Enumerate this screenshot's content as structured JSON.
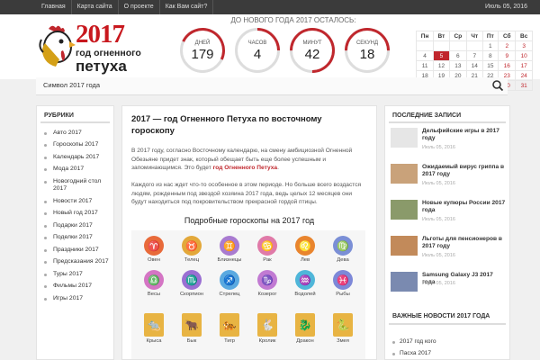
{
  "topbar": {
    "nav": [
      "Главная",
      "Карта сайта",
      "О проекте",
      "Как Вам сайт?"
    ],
    "date": "Июль 05, 2016"
  },
  "logo": {
    "year": "2017",
    "line1": "год огненного",
    "line2": "петуха"
  },
  "countdown": {
    "title": "ДО НОВОГО ГОДА 2017 ОСТАЛОСЬ:",
    "items": [
      {
        "label": "ДНЕЙ",
        "value": "179"
      },
      {
        "label": "ЧАСОВ",
        "value": "4"
      },
      {
        "label": "МИНУТ",
        "value": "42"
      },
      {
        "label": "СЕКУНД",
        "value": "18"
      }
    ]
  },
  "calendar": {
    "days": [
      "Пн",
      "Вт",
      "Ср",
      "Чт",
      "Пт",
      "Сб",
      "Вс"
    ],
    "rows": [
      [
        "",
        "",
        "",
        "",
        "1",
        "2",
        "3"
      ],
      [
        "4",
        "5",
        "6",
        "7",
        "8",
        "9",
        "10"
      ],
      [
        "11",
        "12",
        "13",
        "14",
        "15",
        "16",
        "17"
      ],
      [
        "18",
        "19",
        "20",
        "21",
        "22",
        "23",
        "24"
      ],
      [
        "25",
        "26",
        "27",
        "28",
        "29",
        "30",
        "31"
      ]
    ],
    "today": "5",
    "accent": "#c0272d"
  },
  "menu": {
    "item": "Символ 2017 года"
  },
  "left": {
    "title": "РУБРИКИ",
    "items": [
      "Авто 2017",
      "Гороскопы 2017",
      "Календарь 2017",
      "Мода 2017",
      "Новогодний стол 2017",
      "Новости 2017",
      "Новый год 2017",
      "Подарки 2017",
      "Поделки 2017",
      "Праздники 2017",
      "Предсказания 2017",
      "Туры 2017",
      "Фильмы 2017",
      "Игры 2017"
    ]
  },
  "article": {
    "title": "2017 — год Огненного Петуха по восточному гороскопу",
    "p1_pre": "В 2017 году, согласно Восточному календарю, на смену амбициозной Огненной Обезьяне придет знак, который обещает быть еще более успешным и запоминающимся. Это будет ",
    "p1_bold": "год Огненного Петуха",
    "p1_post": ".",
    "p2": "Каждого из нас ждет что-то особенное в этом периоде. Но больше всего воздастся людям, рожденным под звездой хозяина 2017 года, ведь целых 12 месяцев они будут находиться под покровительством прекрасной гордой птицы.",
    "subtitle": "Подробные гороскопы на 2017 год"
  },
  "zodiac": [
    {
      "name": "Овен",
      "glyph": "♈",
      "color": "#e86a3a"
    },
    {
      "name": "Телец",
      "glyph": "♉",
      "color": "#e3a83a"
    },
    {
      "name": "Близнецы",
      "glyph": "♊",
      "color": "#a97bd0"
    },
    {
      "name": "Рак",
      "glyph": "♋",
      "color": "#e07aa8"
    },
    {
      "name": "Лев",
      "glyph": "♌",
      "color": "#e9852e"
    },
    {
      "name": "Дева",
      "glyph": "♍",
      "color": "#7b8fd6"
    },
    {
      "name": "Весы",
      "glyph": "♎",
      "color": "#d475c4"
    },
    {
      "name": "Скорпион",
      "glyph": "♏",
      "color": "#9a6fd3"
    },
    {
      "name": "Стрелец",
      "glyph": "♐",
      "color": "#5aa9e0"
    },
    {
      "name": "Козерог",
      "glyph": "♑",
      "color": "#c17ad2"
    },
    {
      "name": "Водолей",
      "glyph": "♒",
      "color": "#4fb6d9"
    },
    {
      "name": "Рыбы",
      "glyph": "♓",
      "color": "#7d88d8"
    }
  ],
  "chinese": [
    {
      "name": "Крыса",
      "glyph": "🐀"
    },
    {
      "name": "Бык",
      "glyph": "🐂"
    },
    {
      "name": "Тигр",
      "glyph": "🐅"
    },
    {
      "name": "Кролик",
      "glyph": "🐇"
    },
    {
      "name": "Дракон",
      "glyph": "🐉"
    },
    {
      "name": "Змея",
      "glyph": "🐍"
    }
  ],
  "right": {
    "title": "ПОСЛЕДНИЕ ЗАПИСИ",
    "posts": [
      {
        "title": "Дельфийские игры в 2017 году",
        "date": "Июль 05, 2016"
      },
      {
        "title": "Ожидаемый вирус гриппа в 2017 году",
        "date": "Июль 05, 2016"
      },
      {
        "title": "Новые купюры России 2017 года",
        "date": "Июль 05, 2016"
      },
      {
        "title": "Льготы для пенсионеров в 2017 году",
        "date": "Июль 05, 2016"
      },
      {
        "title": "Samsung Galaxy J3 2017 года",
        "date": "Июль 05, 2016"
      }
    ],
    "news_title": "ВАЖНЫЕ НОВОСТИ 2017 ГОДА",
    "news": [
      "2017 год кого",
      "Пасха 2017"
    ]
  }
}
